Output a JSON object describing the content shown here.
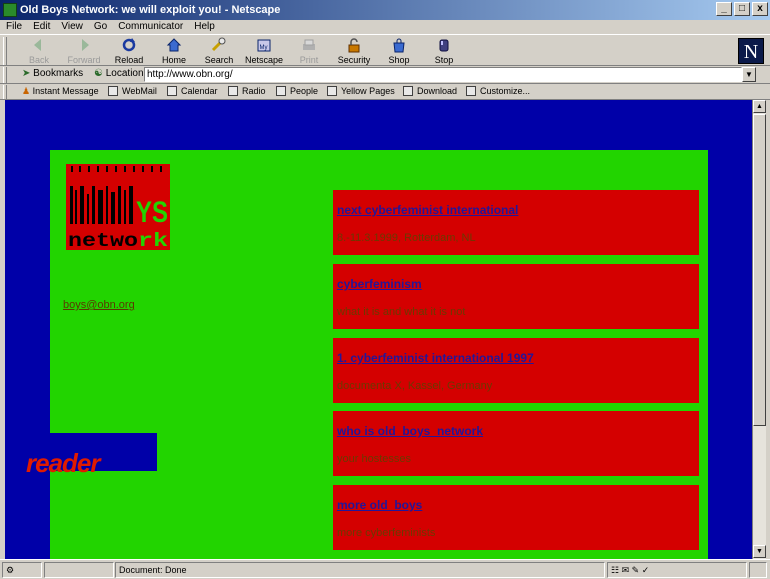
{
  "window": {
    "title": "Old Boys Network: we will exploit you! - Netscape",
    "minimize": "_",
    "maximize": "□",
    "close": "x"
  },
  "menu": [
    "File",
    "Edit",
    "View",
    "Go",
    "Communicator",
    "Help"
  ],
  "toolbar": {
    "back": "Back",
    "forward": "Forward",
    "reload": "Reload",
    "home": "Home",
    "search": "Search",
    "netscape": "Netscape",
    "print": "Print",
    "security": "Security",
    "shop": "Shop",
    "stop": "Stop"
  },
  "brand": "N",
  "location": {
    "bookmarks": "Bookmarks",
    "label": "Location",
    "url": "http://www.obn.org/"
  },
  "personal_toolbar": [
    "Instant Message",
    "WebMail",
    "Calendar",
    "Radio",
    "People",
    "Yellow Pages",
    "Download",
    "Customize..."
  ],
  "page": {
    "logo": {
      "top": "OLDBOYS",
      "bottom": "network"
    },
    "email": "boys@obn.org",
    "reader": "reader",
    "entries": [
      {
        "link": "next cyberfeminist international",
        "desc": "8.-11.3.1999, Rotterdam, NL"
      },
      {
        "link": "cyberfeminism",
        "desc": "what it is and what it is not"
      },
      {
        "link": "1. cyberfeminist international 1997",
        "desc": "documenta X, Kassel, Germany"
      },
      {
        "link": "who is old_boys_network",
        "desc": "your hostesses"
      },
      {
        "link": "more old_boys",
        "desc": "more cyberfeminists"
      }
    ]
  },
  "status": {
    "text": "Document: Done"
  },
  "colors": {
    "viewport_bg": "#0000a8",
    "panel": "#22d400",
    "box": "#d40000",
    "link": "#22169a"
  }
}
